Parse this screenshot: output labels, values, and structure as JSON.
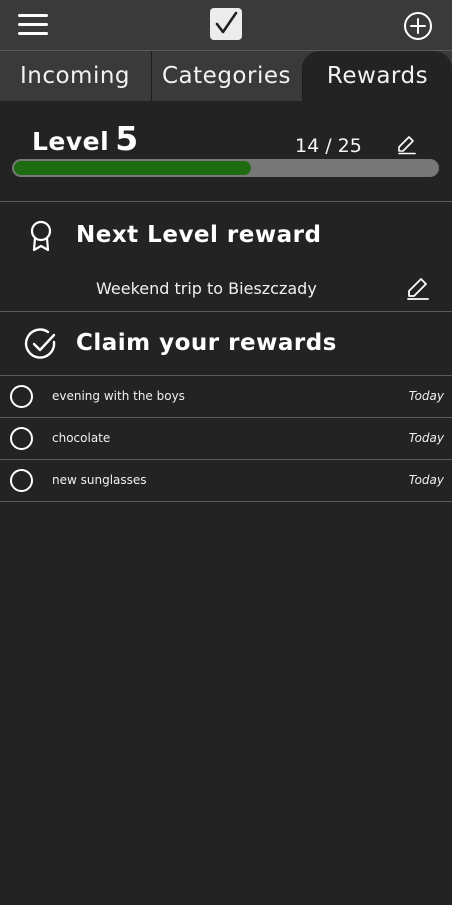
{
  "header": {
    "menu_icon": "hamburger-menu-icon",
    "logo_icon": "checkbox-logo-icon",
    "add_icon": "plus-circle-icon"
  },
  "tabs": [
    {
      "label": "Incoming"
    },
    {
      "label": "Categories"
    },
    {
      "label": "Rewards",
      "active": true
    }
  ],
  "level": {
    "label": "Level",
    "number": "5",
    "progress_text": "14 / 25",
    "current": 14,
    "target": 25
  },
  "next_reward": {
    "title": "Next Level reward",
    "reward_name": "Weekend trip to Bieszczady"
  },
  "claim": {
    "title": "Claim your rewards",
    "items": [
      {
        "label": "evening with the boys",
        "date": "Today"
      },
      {
        "label": "chocolate",
        "date": "Today"
      },
      {
        "label": "new sunglasses",
        "date": "Today"
      }
    ]
  },
  "colors": {
    "background": "#232323",
    "bar": "#3a3a3a",
    "progress_fill": "#1f6b12",
    "progress_track": "#777777"
  }
}
